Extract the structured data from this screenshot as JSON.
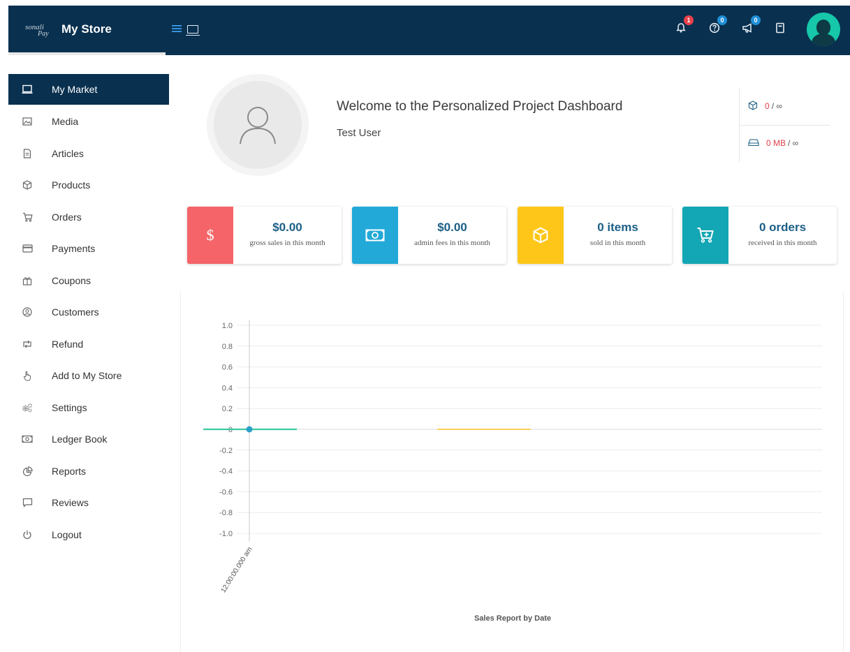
{
  "topbar": {
    "logo_line1": "sonali",
    "logo_line2": "Pay",
    "brand": "My Store",
    "icons": [
      {
        "name": "bell-icon",
        "badge": "1",
        "badge_color": "#e8414a"
      },
      {
        "name": "help-icon",
        "badge": "0",
        "badge_color": "#1f8fd6"
      },
      {
        "name": "megaphone-icon",
        "badge": "0",
        "badge_color": "#1f8fd6"
      },
      {
        "name": "book-icon",
        "badge": "",
        "badge_color": ""
      }
    ]
  },
  "sidebar": {
    "items": [
      {
        "label": "My Market",
        "icon": "laptop-icon",
        "active": true
      },
      {
        "label": "Media",
        "icon": "image-icon"
      },
      {
        "label": "Articles",
        "icon": "document-icon"
      },
      {
        "label": "Products",
        "icon": "cube-icon"
      },
      {
        "label": "Orders",
        "icon": "cart-icon"
      },
      {
        "label": "Payments",
        "icon": "credit-card-icon"
      },
      {
        "label": "Coupons",
        "icon": "gift-icon"
      },
      {
        "label": "Customers",
        "icon": "user-circle-icon"
      },
      {
        "label": "Refund",
        "icon": "retweet-icon"
      },
      {
        "label": "Add to My Store",
        "icon": "hand-pointer-icon"
      },
      {
        "label": "Settings",
        "icon": "cogs-icon"
      },
      {
        "label": "Ledger Book",
        "icon": "money-bill-icon"
      },
      {
        "label": "Reports",
        "icon": "chart-pie-icon"
      },
      {
        "label": "Reviews",
        "icon": "comment-icon"
      },
      {
        "label": "Logout",
        "icon": "power-icon"
      }
    ]
  },
  "welcome": {
    "title": "Welcome to the Personalized Project Dashboard",
    "user": "Test User"
  },
  "quota": {
    "products_value": "0",
    "products_max": "/ ∞",
    "storage_value": "0 MB",
    "storage_max": "/ ∞"
  },
  "stats": [
    {
      "value": "$0.00",
      "label": "gross sales in this month",
      "color": "#f46468",
      "icon": "dollar-icon"
    },
    {
      "value": "$0.00",
      "label": "admin fees in this month",
      "color": "#22a9d8",
      "icon": "money-bill-icon"
    },
    {
      "value": "0 items",
      "label": "sold in this month",
      "color": "#fec619",
      "icon": "cube-icon"
    },
    {
      "value": "0 orders",
      "label": "received in this month",
      "color": "#13a6b4",
      "icon": "cart-plus-icon"
    }
  ],
  "chart_data": {
    "type": "line",
    "title": "Sales Report by Date",
    "ylim": [
      -1.0,
      1.0
    ],
    "yticks": [
      "1.0",
      "0.8",
      "0.6",
      "0.4",
      "0.2",
      "0",
      "-0.2",
      "-0.4",
      "-0.6",
      "-0.8",
      "-1.0"
    ],
    "xticks": [
      "12:00:00.000 am"
    ],
    "series": [
      {
        "values": [
          0
        ],
        "color": "#3dc9a3"
      },
      {
        "values": [
          0
        ],
        "color": "#fcd157"
      }
    ]
  }
}
